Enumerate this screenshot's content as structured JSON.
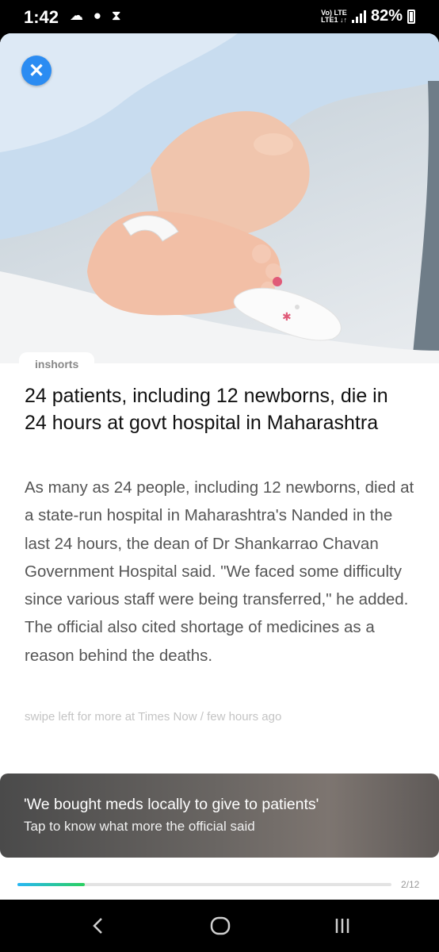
{
  "status_bar": {
    "time": "1:42",
    "left_icons": [
      "notification-icon",
      "messenger-icon",
      "hourglass-icon"
    ],
    "network": "Vo) LTE LTE1",
    "battery": "82%"
  },
  "article": {
    "close_icon": "close-icon",
    "source": "inshorts",
    "headline": "24 patients, including 12 newborns, die in 24 hours at govt hospital in Maharashtra",
    "summary": "As many as 24 people, including 12 newborns, died at a state-run hospital in Maharashtra's Nanded in the last 24 hours, the dean of Dr Shankarrao Chavan Government Hospital said. \"We faced some difficulty since various staff were being transferred,\" he added. The official also cited shortage of medicines as a reason behind the deaths.",
    "byline": "swipe left for more at Times Now / few hours ago"
  },
  "footer_card": {
    "title": "'We bought meds locally to give to patients'",
    "subtitle": "Tap to know what more the official said"
  },
  "progress": {
    "count": "2/12",
    "fraction": 0.18
  },
  "nav_bar": {
    "back_icon": "back-icon",
    "home_icon": "home-icon",
    "recents_icon": "recents-icon"
  },
  "colors": {
    "accent": "#2b8cf2",
    "progress_start": "#28b7f5",
    "progress_end": "#2ad05f"
  }
}
